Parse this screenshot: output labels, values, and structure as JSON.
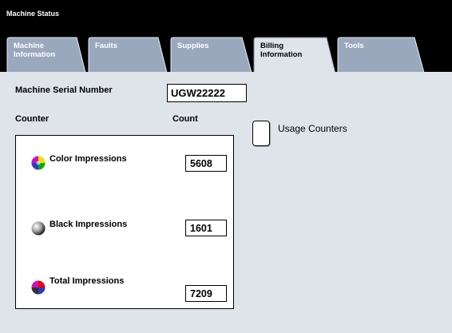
{
  "window": {
    "title": "Machine Status"
  },
  "tabs": [
    {
      "label": "Machine\nInformation",
      "active": false
    },
    {
      "label": "Faults",
      "active": false
    },
    {
      "label": "Supplies",
      "active": false
    },
    {
      "label": "Billing\nInformation",
      "active": true
    },
    {
      "label": "Tools",
      "active": false
    }
  ],
  "billing": {
    "serial_label": "Machine Serial Number",
    "serial_value": "UGW22222",
    "counter_header": "Counter",
    "count_header": "Count",
    "rows": [
      {
        "label": "Color Impressions",
        "value": "5608",
        "icon": "color-wheel-icon"
      },
      {
        "label": "Black Impressions",
        "value": "1601",
        "icon": "black-sphere-icon"
      },
      {
        "label": "Total Impressions",
        "value": "7209",
        "icon": "total-wheel-icon"
      }
    ],
    "usage_counters_label": "Usage Counters"
  },
  "colors": {
    "tab_fill": "#9aa8bd",
    "active_tab_fill": "#dfe4ea",
    "content_bg": "#dfe4ea"
  }
}
